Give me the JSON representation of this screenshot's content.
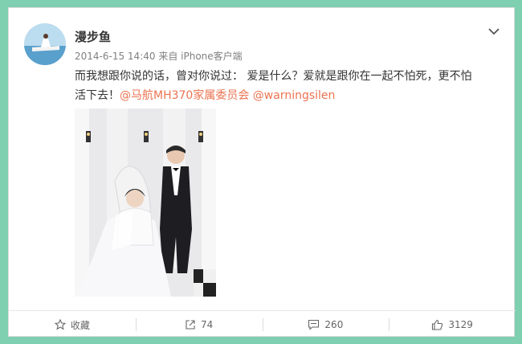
{
  "post": {
    "username": "漫步鱼",
    "timestamp": "2014-6-15 14:40",
    "source": "来自 iPhone客户端",
    "text_line1": "而我想跟你说的话，曾对你说过： 爱是什么？爱就是跟你在一起不怕死，更不怕",
    "text_line2_prefix": "活下去！",
    "mention1": "@马航MH370家属委员会",
    "mention2": "@warningsilen"
  },
  "actions": {
    "favorite_label": "收藏",
    "repost_count": "74",
    "comment_count": "260",
    "like_count": "3129"
  },
  "icons": [
    "chevron-down-icon",
    "star-icon",
    "share-icon",
    "comment-icon",
    "thumbs-up-icon"
  ],
  "colors": {
    "background": "#7fd0b0",
    "mention": "#eb7350"
  }
}
